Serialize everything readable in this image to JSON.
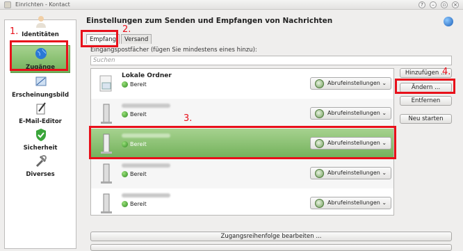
{
  "window": {
    "title": "Einrichten - Kontact"
  },
  "sidebar": {
    "items": [
      {
        "label": "Identitäten"
      },
      {
        "label": "Zugänge"
      },
      {
        "label": "Erscheinungsbild"
      },
      {
        "label": "E-Mail-Editor"
      },
      {
        "label": "Sicherheit"
      },
      {
        "label": "Diverses"
      }
    ]
  },
  "main": {
    "heading": "Einstellungen zum Senden und Empfangen von Nachrichten",
    "tabs": [
      {
        "label": "Empfang"
      },
      {
        "label": "Versand"
      }
    ],
    "sublabel": "Eingangspostfächer (fügen Sie mindestens eines hinzu):",
    "search_placeholder": "Suchen",
    "accounts": [
      {
        "name": "Lokale Ordner",
        "status": "Bereit",
        "fetch": "Abrufeinstellungen"
      },
      {
        "name": "",
        "status": "Bereit",
        "fetch": "Abrufeinstellungen"
      },
      {
        "name": "",
        "status": "Bereit",
        "fetch": "Abrufeinstellungen"
      },
      {
        "name": "",
        "status": "Bereit",
        "fetch": "Abrufeinstellungen"
      },
      {
        "name": "",
        "status": "Bereit",
        "fetch": "Abrufeinstellungen"
      }
    ],
    "buttons": {
      "add": "Hinzufügen ...",
      "change": "Ändern ...",
      "remove": "Entfernen",
      "restart": "Neu starten"
    },
    "order_button": "Zugangsreihenfolge bearbeiten ..."
  },
  "annotations": {
    "n1": "1.",
    "n2": "2.",
    "n3": "3.",
    "n4": "4."
  }
}
